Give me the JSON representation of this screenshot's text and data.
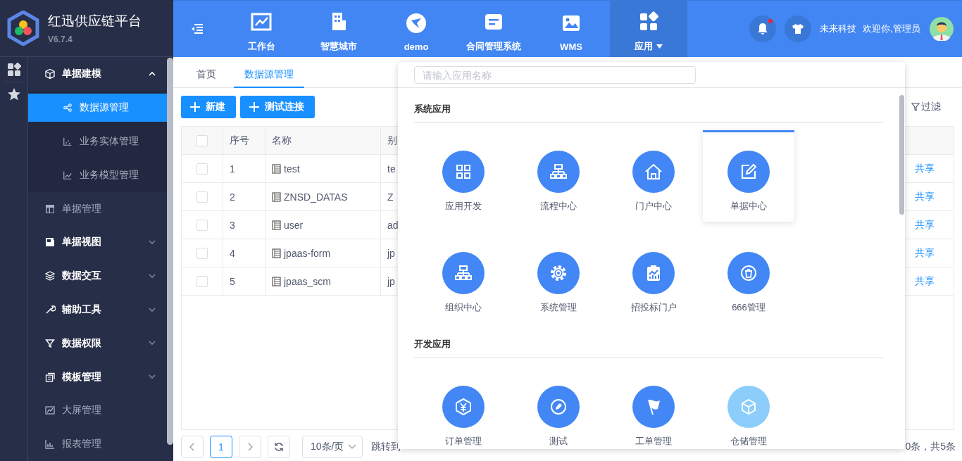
{
  "brand": {
    "title": "红迅供应链平台",
    "version": "V6.7.4"
  },
  "nav": [
    {
      "label": "工作台",
      "selected": false
    },
    {
      "label": "智慧城市",
      "selected": false
    },
    {
      "label": "demo",
      "selected": false
    },
    {
      "label": "合同管理系统",
      "selected": false
    },
    {
      "label": "WMS",
      "selected": false
    },
    {
      "label": "应用",
      "selected": true
    }
  ],
  "user": {
    "company": "未来科技",
    "greeting": "欢迎你,管理员",
    "notification": true
  },
  "menu": [
    {
      "kind": "group",
      "label": "单据建模",
      "expanded": true,
      "children": [
        {
          "label": "数据源管理",
          "selected": true
        },
        {
          "label": "业务实体管理",
          "selected": false
        },
        {
          "label": "业务模型管理",
          "selected": false
        }
      ]
    },
    {
      "kind": "link",
      "label": "单据管理"
    },
    {
      "kind": "group",
      "label": "单据视图",
      "expanded": false
    },
    {
      "kind": "group",
      "label": "数据交互",
      "expanded": false
    },
    {
      "kind": "group",
      "label": "辅助工具",
      "expanded": false
    },
    {
      "kind": "group",
      "label": "数据权限",
      "expanded": false
    },
    {
      "kind": "group",
      "label": "模板管理",
      "expanded": false
    },
    {
      "kind": "link",
      "label": "大屏管理"
    },
    {
      "kind": "link",
      "label": "报表管理"
    }
  ],
  "tabs": [
    {
      "label": "首页",
      "selected": false
    },
    {
      "label": "数据源管理",
      "selected": true
    }
  ],
  "buttons": [
    "新建",
    "测试连接"
  ],
  "filter": "过滤",
  "table": {
    "all_checked": false,
    "columns": [
      "序号",
      "名称",
      "别"
    ],
    "rows": [
      {
        "checked": false,
        "index": "1",
        "name": "test",
        "alias": "te",
        "action": "共享"
      },
      {
        "checked": false,
        "index": "2",
        "name": "ZNSD_DATAS",
        "alias": "Z",
        "action": "共享"
      },
      {
        "checked": false,
        "index": "3",
        "name": "user",
        "alias": "ad",
        "action": "共享"
      },
      {
        "checked": false,
        "index": "4",
        "name": "jpaas-form",
        "alias": "jp",
        "action": "共享"
      },
      {
        "checked": false,
        "index": "5",
        "name": "jpaas_scm",
        "alias": "jp",
        "action": "共享"
      }
    ]
  },
  "pagination": {
    "page": "1",
    "page_size": "10条/页",
    "jump": "跳转到",
    "total": "0条，共5条"
  },
  "app_menu": {
    "placeholder": "请输入应用名称",
    "sections": [
      {
        "title": "系统应用",
        "apps": [
          {
            "label": "应用开发",
            "color": "#4287f5",
            "selected": false
          },
          {
            "label": "流程中心",
            "color": "#4287f5",
            "selected": false
          },
          {
            "label": "门户中心",
            "color": "#4287f5",
            "selected": false
          },
          {
            "label": "单据中心",
            "color": "#4287f5",
            "selected": true
          },
          {
            "label": "组织中心",
            "color": "#4287f5",
            "selected": false
          },
          {
            "label": "系统管理",
            "color": "#4287f5",
            "selected": false
          },
          {
            "label": "招投标门户",
            "color": "#4287f5",
            "selected": false
          },
          {
            "label": "666管理",
            "color": "#4287f5",
            "selected": false
          }
        ]
      },
      {
        "title": "开发应用",
        "apps": [
          {
            "label": "订单管理",
            "color": "#4287f5",
            "selected": false
          },
          {
            "label": "测试",
            "color": "#4287f5",
            "selected": false
          },
          {
            "label": "工单管理",
            "color": "#4287f5",
            "selected": false
          },
          {
            "label": "仓储管理",
            "color": "#8ccdfb",
            "selected": false
          }
        ]
      }
    ]
  }
}
